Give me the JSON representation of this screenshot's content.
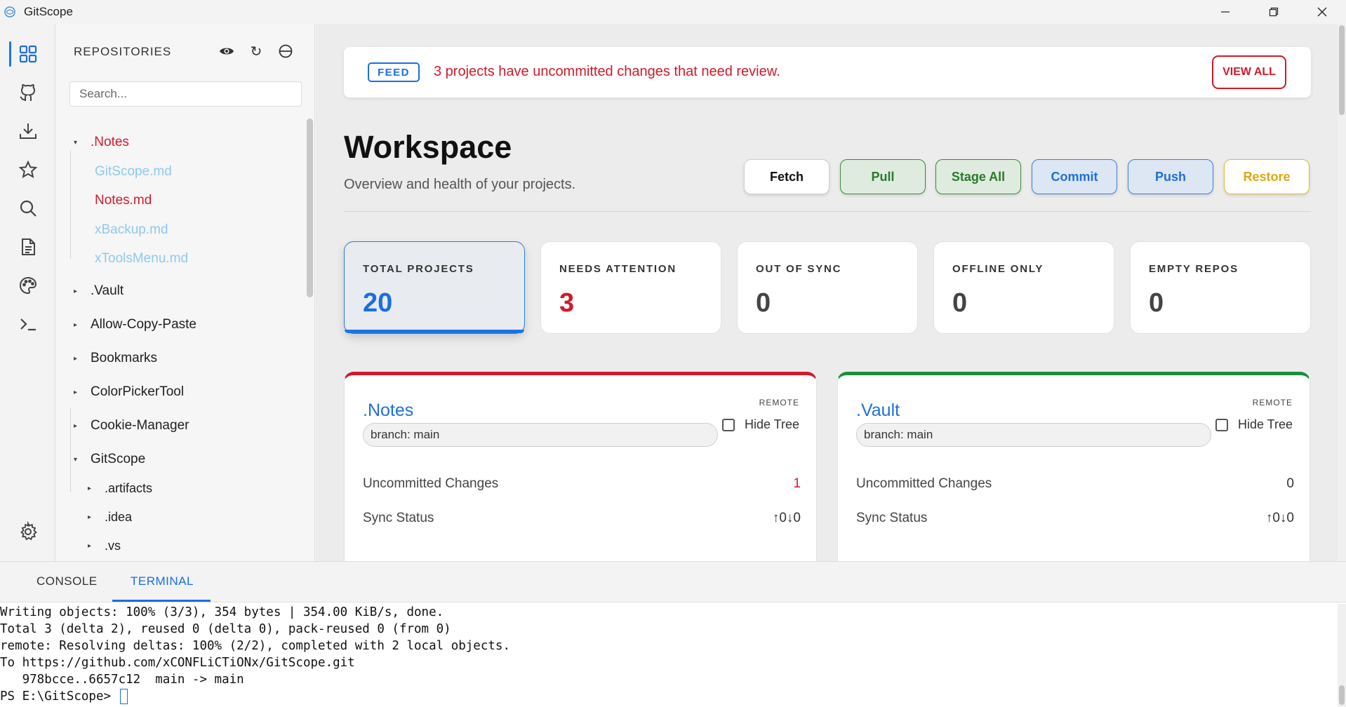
{
  "window": {
    "title": "GitScope",
    "controls": [
      "minimize-icon",
      "restore-icon",
      "close-icon"
    ]
  },
  "activity_bar": {
    "items": [
      {
        "icon": "dashboard-icon",
        "active": true
      },
      {
        "icon": "github-icon"
      },
      {
        "icon": "download-icon"
      },
      {
        "icon": "star-icon"
      },
      {
        "icon": "search-icon"
      },
      {
        "icon": "document-icon"
      },
      {
        "icon": "palette-icon"
      },
      {
        "icon": "terminal-icon"
      },
      {
        "icon": "settings-icon"
      }
    ]
  },
  "sidebar": {
    "header": "REPOSITORIES",
    "actions": [
      "eye-icon",
      "refresh-icon",
      "collapse-icon"
    ],
    "search_placeholder": "Search...",
    "tree": [
      {
        "label": ".Notes",
        "expanded": true,
        "color": "#d11a2a"
      },
      {
        "label": "GitScope.md",
        "color": "#8ec9ef"
      },
      {
        "label": "Notes.md",
        "color": "#d11a2a"
      },
      {
        "label": "xBackup.md",
        "color": "#8ec9ef"
      },
      {
        "label": "xToolsMenu.md",
        "color": "#8ec9ef"
      },
      {
        "label": ".Vault",
        "expanded": false
      },
      {
        "label": "Allow-Copy-Paste",
        "expanded": false
      },
      {
        "label": "Bookmarks",
        "expanded": false
      },
      {
        "label": "ColorPickerTool",
        "expanded": false
      },
      {
        "label": "Cookie-Manager",
        "expanded": false
      },
      {
        "label": "GitScope",
        "expanded": true
      },
      {
        "label": ".artifacts",
        "expanded": false
      },
      {
        "label": ".idea",
        "expanded": false
      },
      {
        "label": ".vs",
        "expanded": false
      }
    ]
  },
  "feed": {
    "badge": "FEED",
    "message": "3 projects have uncommitted changes that need review.",
    "button": "VIEW ALL"
  },
  "workspace": {
    "title": "Workspace",
    "subtitle": "Overview and health of your projects.",
    "buttons": {
      "fetch": "Fetch",
      "pull": "Pull",
      "stage_all": "Stage All",
      "commit": "Commit",
      "push": "Push",
      "restore": "Restore"
    }
  },
  "stats": [
    {
      "label": "TOTAL PROJECTS",
      "value": "20",
      "color": "#1a6fe0",
      "active": true
    },
    {
      "label": "NEEDS ATTENTION",
      "value": "3",
      "color": "#d11a2a"
    },
    {
      "label": "OUT OF SYNC",
      "value": "0"
    },
    {
      "label": "OFFLINE ONLY",
      "value": "0"
    },
    {
      "label": "EMPTY REPOS",
      "value": "0"
    }
  ],
  "repos": [
    {
      "name": ".Notes",
      "remote": "REMOTE",
      "branch": "branch: main",
      "hide_tree": "Hide Tree",
      "uncommitted_label": "Uncommitted Changes",
      "uncommitted_value": "1",
      "sync_label": "Sync Status",
      "sync_value": "↑0↓0",
      "accent": "#d11a2a"
    },
    {
      "name": ".Vault",
      "remote": "REMOTE",
      "branch": "branch: main",
      "hide_tree": "Hide Tree",
      "uncommitted_label": "Uncommitted Changes",
      "uncommitted_value": "0",
      "sync_label": "Sync Status",
      "sync_value": "↑0↓0",
      "accent": "#1e8e3e"
    }
  ],
  "panel": {
    "tabs": [
      "CONSOLE",
      "TERMINAL"
    ],
    "active_tab": "TERMINAL",
    "terminal_lines": [
      "Writing objects: 100% (3/3), 354 bytes | 354.00 KiB/s, done.",
      "Total 3 (delta 2), reused 0 (delta 0), pack-reused 0 (from 0)",
      "remote: Resolving deltas: 100% (2/2), completed with 2 local objects.",
      "To https://github.com/xCONFLiCTiONx/GitScope.git",
      "   978bcce..6657c12  main -> main",
      "PS E:\\GitScope> "
    ]
  }
}
